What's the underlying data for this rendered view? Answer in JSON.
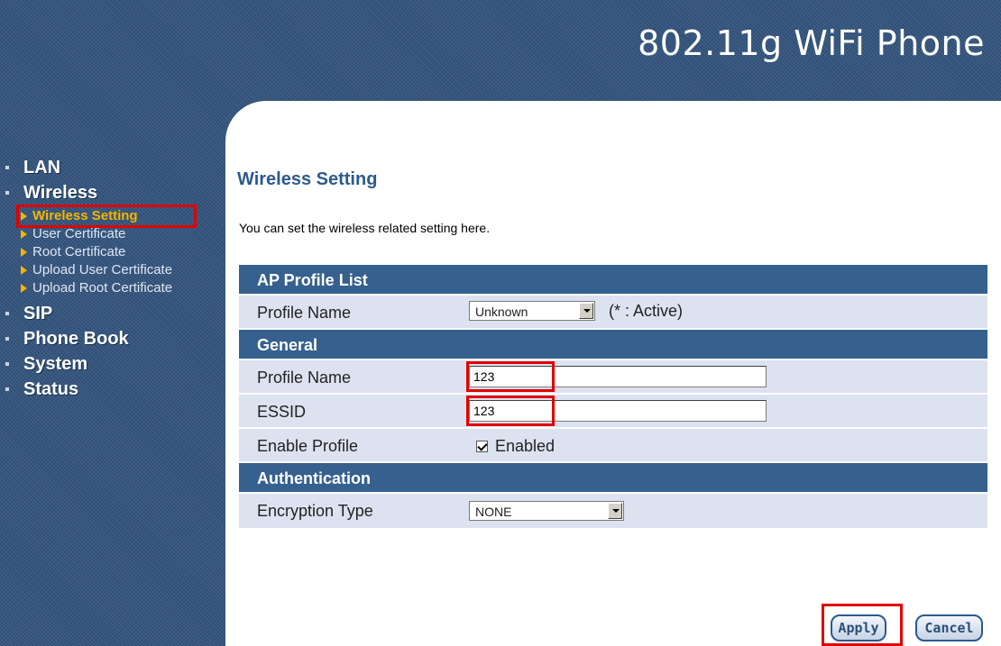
{
  "header": {
    "title": "802.11g WiFi Phone"
  },
  "sidebar": {
    "items": [
      {
        "label": "LAN"
      },
      {
        "label": "Wireless",
        "subitems": [
          {
            "label": "Wireless Setting",
            "active": true
          },
          {
            "label": "User Certificate"
          },
          {
            "label": "Root Certificate"
          },
          {
            "label": "Upload User Certificate"
          },
          {
            "label": "Upload Root Certificate"
          }
        ]
      },
      {
        "label": "SIP"
      },
      {
        "label": "Phone Book"
      },
      {
        "label": "System"
      },
      {
        "label": "Status"
      }
    ]
  },
  "page": {
    "title": "Wireless Setting",
    "description": "You can set the wireless related setting here."
  },
  "ap_profile_list": {
    "header": "AP Profile List",
    "profile_name_label": "Profile Name",
    "profile_select_value": "Unknown",
    "active_note": "(* : Active)"
  },
  "general": {
    "header": "General",
    "profile_name_label": "Profile Name",
    "profile_name_value": "123",
    "essid_label": "ESSID",
    "essid_value": "123",
    "enable_profile_label": "Enable Profile",
    "enabled_label": "Enabled",
    "enabled_checked": true
  },
  "authentication": {
    "header": "Authentication",
    "encryption_type_label": "Encryption Type",
    "encryption_type_value": "NONE"
  },
  "buttons": {
    "apply": "Apply",
    "cancel": "Cancel"
  },
  "colors": {
    "sidebar_bg": "#34557e",
    "section_header": "#36608e",
    "row_bg": "#dde2f0",
    "highlight": "#e00000",
    "active_nav": "#f5b400"
  }
}
